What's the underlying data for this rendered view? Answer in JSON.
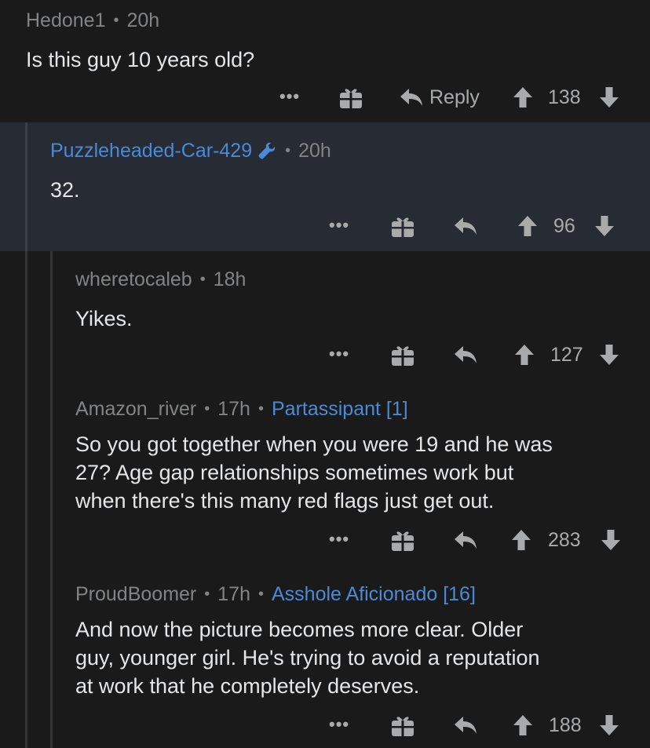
{
  "comments": [
    {
      "author": "Hedone1",
      "time": "20h",
      "flair": "",
      "body": "Is this guy 10 years old?",
      "reply_label": "Reply",
      "score": "138"
    },
    {
      "author": "Puzzleheaded-Car-429",
      "time": "20h",
      "flair": "",
      "body": "32.",
      "reply_label": "",
      "score": "96"
    },
    {
      "author": "wheretocaleb",
      "time": "18h",
      "flair": "",
      "body": "Yikes.",
      "reply_label": "",
      "score": "127"
    },
    {
      "author": "Amazon_river",
      "time": "17h",
      "flair": "Partassipant [1]",
      "body_lines": [
        "So you got together when you were 19 and he was",
        "27? Age gap relationships sometimes work but",
        "when there's this many red flags just get out."
      ],
      "reply_label": "",
      "score": "283"
    },
    {
      "author": "ProudBoomer",
      "time": "17h",
      "flair": "Asshole Aficionado [16]",
      "body_lines": [
        "And now the picture becomes more clear. Older",
        "guy, younger girl. He's trying to avoid a reputation",
        "at work that he completely deserves."
      ],
      "reply_label": "",
      "score": "188"
    }
  ],
  "icons": {
    "more": "more-icon",
    "gift": "gift-icon",
    "reply": "reply-icon",
    "upvote": "upvote-icon",
    "downvote": "downvote-icon",
    "op_badge": "wrench-icon"
  },
  "colors": {
    "background": "#1a1a1b",
    "highlight": "#272b33",
    "op_author": "#4a8ad6",
    "flair": "#4a8ad6",
    "meta": "#818384"
  }
}
